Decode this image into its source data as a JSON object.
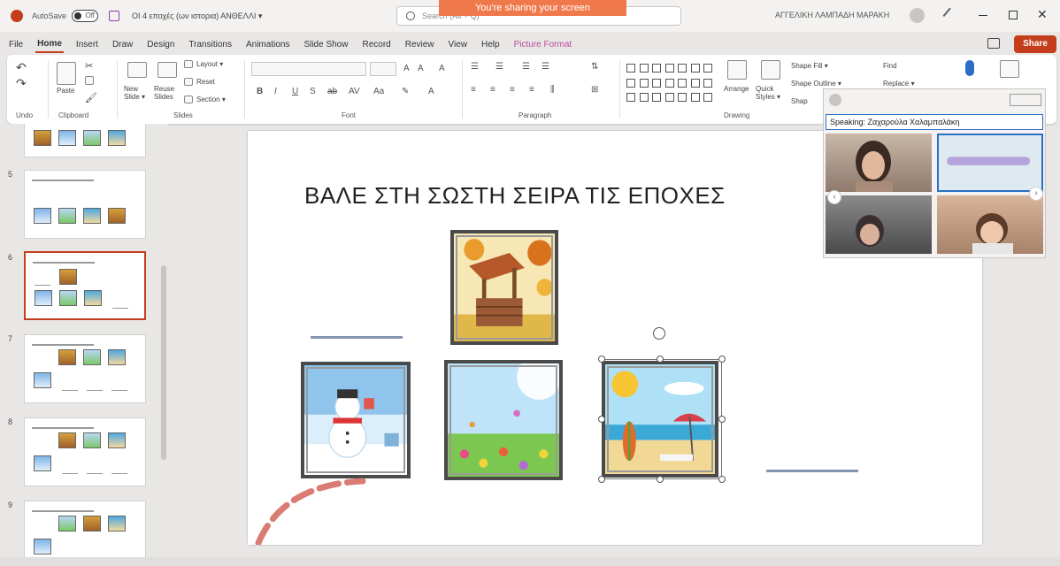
{
  "titlebar": {
    "autosave_label": "AutoSave",
    "autosave_state": "Off",
    "doc_title": "ΟΙ 4 εποχές (ων ιστορια) ΑΝΘΕΛΛΙ ▾",
    "search_text": "Search (Alt + Q)",
    "sharing_banner": "You're sharing your screen",
    "user_name": "ΑΓΓΕΛΙΚΗ ΛΑΜΠΑΔΗ ΜΑΡΑΚΗ",
    "close_glyph": "✕"
  },
  "tabs": [
    "File",
    "Home",
    "Insert",
    "Draw",
    "Design",
    "Transitions",
    "Animations",
    "Slide Show",
    "Record",
    "Review",
    "View",
    "Help",
    "Picture Format"
  ],
  "active_tab": "Home",
  "share_label": "Share",
  "ribbon": {
    "undo_label": "Undo",
    "paste_label": "Paste",
    "clipboard_label": "Clipboard",
    "new_slide_label": "New Slide ▾",
    "reuse_slides_label": "Reuse Slides",
    "layout_label": "Layout ▾",
    "reset_label": "Reset",
    "section_label": "Section ▾",
    "slides_label": "Slides",
    "font_label": "Font",
    "paragraph_label": "Paragraph",
    "drawing_label": "Drawing",
    "arrange_label": "Arrange",
    "quick_styles_label": "Quick Styles ▾",
    "shape_fill_label": "Shape Fill ▾",
    "shape_outline_label": "Shape Outline ▾",
    "shape_effects_label": "Shap",
    "find_label": "Find",
    "replace_label": "Replace ▾"
  },
  "thumbnails": [
    {
      "number": "",
      "selected": false
    },
    {
      "number": "5",
      "selected": false
    },
    {
      "number": "6",
      "selected": true
    },
    {
      "number": "7",
      "selected": false
    },
    {
      "number": "8",
      "selected": false
    },
    {
      "number": "9",
      "selected": false
    }
  ],
  "slide": {
    "title": "ΒΑΛΕ ΣΤΗ ΣΩΣΤΗ ΣΕΙΡΑ ΤΙΣ ΕΠΟΧΕΣ"
  },
  "video_panel": {
    "speaking_text": "Speaking: Ζαχαρούλα Χαλαμπαλάκη",
    "prev_glyph": "‹",
    "next_glyph": "›"
  },
  "colors": {
    "accent": "#c43e1c",
    "sharing_banner": "#f0794b",
    "blank_line": "#8496b0"
  }
}
